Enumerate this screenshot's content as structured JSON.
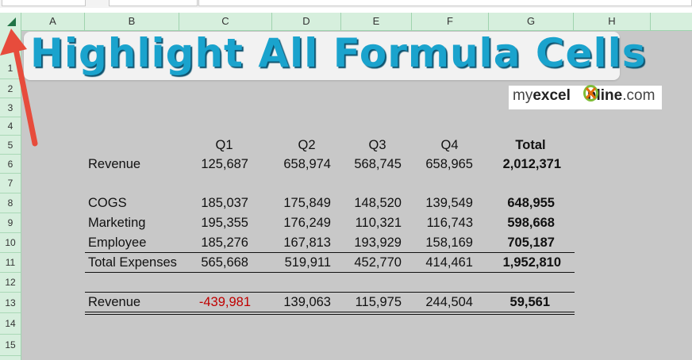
{
  "columns": [
    "A",
    "B",
    "C",
    "D",
    "E",
    "F",
    "G",
    "H"
  ],
  "rows": [
    "1",
    "2",
    "3",
    "4",
    "5",
    "6",
    "7",
    "8",
    "9",
    "10",
    "11",
    "12",
    "13",
    "14",
    "15"
  ],
  "banner": {
    "title": "Highlight All Formula Cells"
  },
  "logo": {
    "part1": "my",
    "part2": "excel",
    "part3": "nline",
    "part4": ".com"
  },
  "table": {
    "headers": [
      "Q1",
      "Q2",
      "Q3",
      "Q4",
      "Total"
    ],
    "revenue": {
      "label": "Revenue",
      "values": [
        "125,687",
        "658,974",
        "568,745",
        "658,965"
      ],
      "total": "2,012,371"
    },
    "cogs": {
      "label": "COGS",
      "values": [
        "185,037",
        "175,849",
        "148,520",
        "139,549"
      ],
      "total": "648,955"
    },
    "marketing": {
      "label": "Marketing",
      "values": [
        "195,355",
        "176,249",
        "110,321",
        "116,743"
      ],
      "total": "598,668"
    },
    "employee": {
      "label": "Employee",
      "values": [
        "185,276",
        "167,813",
        "193,929",
        "158,169"
      ],
      "total": "705,187"
    },
    "total_expenses": {
      "label": "Total Expenses",
      "values": [
        "565,668",
        "519,911",
        "452,770",
        "414,461"
      ],
      "total": "1,952,810"
    },
    "net": {
      "label": "Revenue",
      "values": [
        "-439,981",
        "139,063",
        "115,975",
        "244,504"
      ],
      "total": "59,561"
    }
  },
  "colors": {
    "accent_green": "#217346",
    "header_green": "#d6efdd",
    "negative_red": "#c00000",
    "banner_blue": "#1aa3cd",
    "arrow_red": "#e74c3c"
  },
  "icons": [
    "select-all-icon",
    "annotation-arrow-icon",
    "logo-x-icon"
  ]
}
